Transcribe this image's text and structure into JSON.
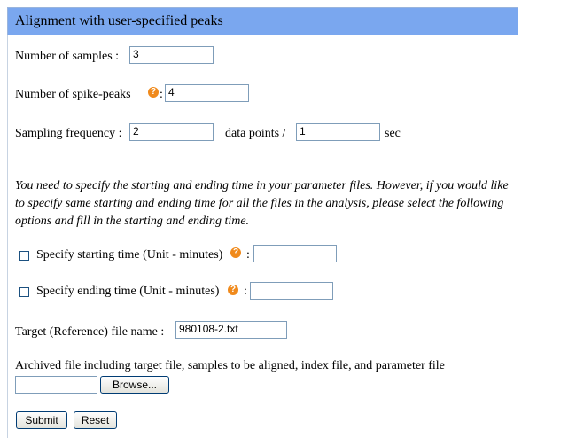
{
  "header": {
    "title": "Alignment with user-specified peaks"
  },
  "samples": {
    "label": "Number of samples :",
    "value": "3"
  },
  "spike_peaks": {
    "label": "Number of spike-peaks",
    "colon": ":",
    "value": "4"
  },
  "sampling": {
    "label": "Sampling frequency :",
    "points_value": "2",
    "mid_label": "data points /",
    "sec_value": "1",
    "unit": "sec"
  },
  "note": "You need to specify the starting and ending time in your parameter files. However, if you would like to specify same starting and ending time for all the files in the analysis, please select the following options and fill in the starting and ending time.",
  "start_time": {
    "label": "Specify starting time (Unit - minutes)",
    "colon": ":",
    "checked": false,
    "value": ""
  },
  "end_time": {
    "label": "Specify ending time (Unit - minutes)",
    "colon": ":",
    "checked": false,
    "value": ""
  },
  "target": {
    "label": "Target (Reference) file name :",
    "value": "980108-2.txt"
  },
  "archive": {
    "label": "Archived file including target file, samples to be aligned, index file, and parameter file",
    "value": "",
    "browse_label": "Browse..."
  },
  "buttons": {
    "submit_label": "Submit",
    "reset_label": "Reset"
  },
  "icons": {
    "help": "help-icon",
    "help_color": "#f08a1c",
    "header_color": "#7aa7ef"
  }
}
